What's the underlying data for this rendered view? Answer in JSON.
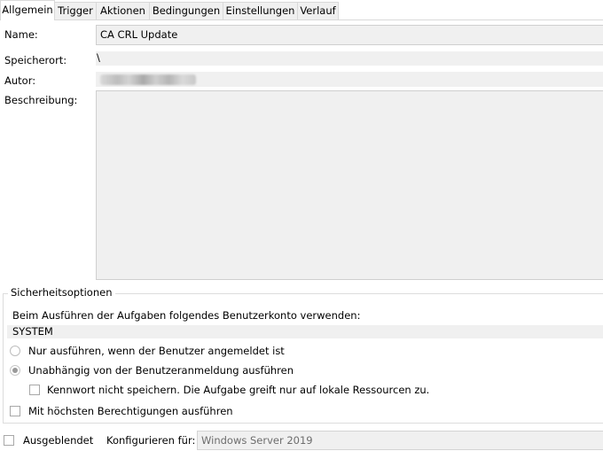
{
  "tabs": [
    {
      "label": "Allgemein",
      "active": true
    },
    {
      "label": "Trigger"
    },
    {
      "label": "Aktionen"
    },
    {
      "label": "Bedingungen"
    },
    {
      "label": "Einstellungen"
    },
    {
      "label": "Verlauf"
    }
  ],
  "general": {
    "name_label": "Name:",
    "name_value": "CA CRL Update",
    "location_label": "Speicherort:",
    "location_value": "\\",
    "author_label": "Autor:",
    "author_value": "",
    "description_label": "Beschreibung:",
    "description_value": ""
  },
  "security": {
    "group_title": "Sicherheitsoptionen",
    "account_prompt": "Beim Ausführen der Aufgaben folgendes Benutzerkonto verwenden:",
    "account_value": "SYSTEM",
    "radio_logged_on": "Nur ausführen, wenn der Benutzer angemeldet ist",
    "radio_independent": "Unabhängig von der Benutzeranmeldung ausführen",
    "no_password_label": "Kennwort nicht speichern. Die Aufgabe greift nur auf lokale Ressourcen zu.",
    "highest_privileges_label": "Mit höchsten Berechtigungen ausführen"
  },
  "footer": {
    "hidden_label": "Ausgeblendet",
    "configure_label": "Konfigurieren für:",
    "configure_value": "Windows Server 2019"
  }
}
